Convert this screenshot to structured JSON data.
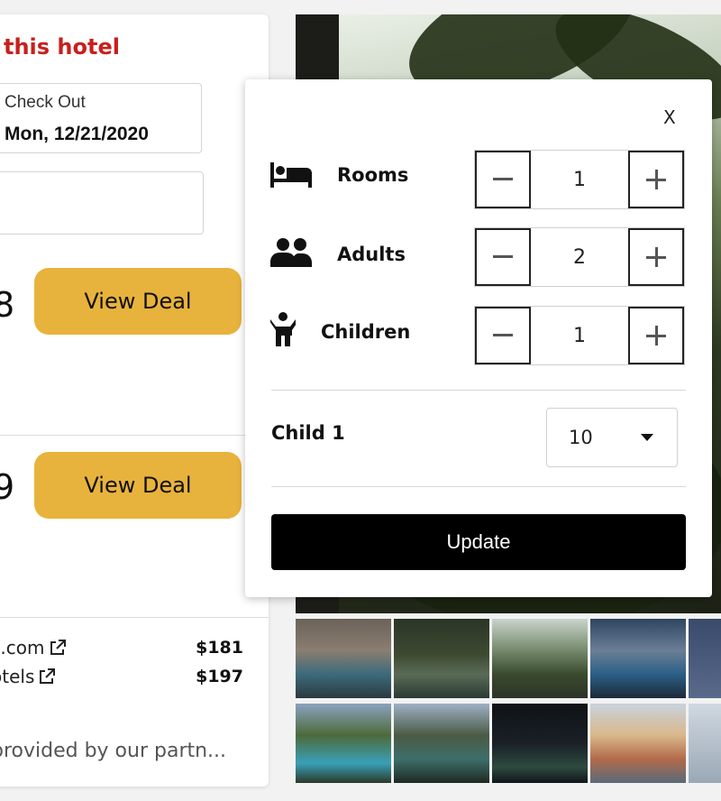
{
  "hotel": {
    "title": "this hotel",
    "checkout_label": "Check Out",
    "checkout_date": "Mon, 12/21/2020"
  },
  "deals": [
    {
      "price_partial": "8",
      "sub_partial": ")",
      "button": "View Deal"
    },
    {
      "price_partial": "9",
      "sub_partial": ")",
      "button": "View Deal"
    }
  ],
  "partners": [
    {
      "name": "s.com",
      "price": "$181"
    },
    {
      "name": "otels",
      "price": "$197"
    }
  ],
  "note": "provided by our partn...",
  "guest_popup": {
    "close": "X",
    "rows": [
      {
        "label": "Rooms",
        "icon": "bed-icon",
        "value": "1"
      },
      {
        "label": "Adults",
        "icon": "users-icon",
        "value": "2"
      },
      {
        "label": "Children",
        "icon": "child-icon",
        "value": "1"
      }
    ],
    "child_label": "Child 1",
    "child_age": "10",
    "update": "Update"
  },
  "colors": {
    "title_red": "#c8201d",
    "deal_yellow": "#e8b33c",
    "update_black": "#000000"
  }
}
